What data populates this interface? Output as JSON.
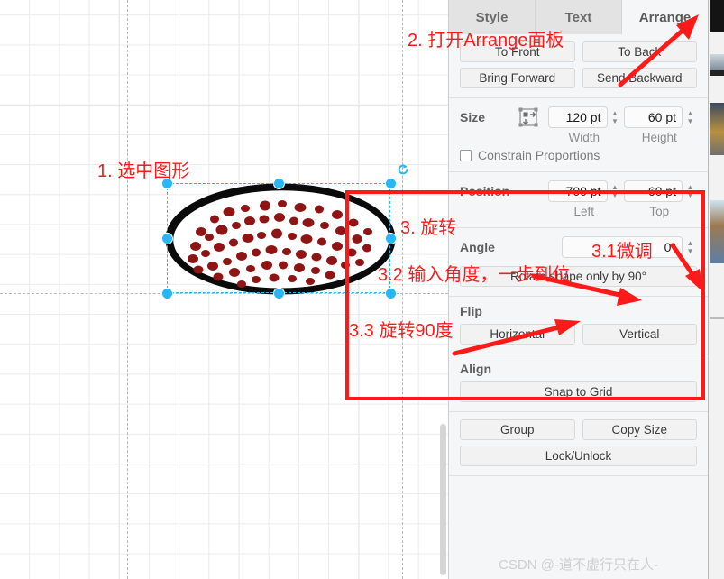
{
  "app": {
    "watermark": "CSDN @-道不虚行只在人-"
  },
  "panel": {
    "tabs": [
      {
        "label": "Style",
        "active": false
      },
      {
        "label": "Text",
        "active": false
      },
      {
        "label": "Arrange",
        "active": true
      }
    ],
    "order": {
      "to_front": "To Front",
      "to_back": "To Back",
      "bring_forward": "Bring Forward",
      "send_backward": "Send Backward"
    },
    "size": {
      "label": "Size",
      "icon": "autosize-icon",
      "width_value": "120 pt",
      "height_value": "60 pt",
      "width_label": "Width",
      "height_label": "Height",
      "constrain_label": "Constrain Proportions",
      "constrain_checked": false
    },
    "position": {
      "label": "Position",
      "left_value": "700 pt",
      "top_value": "-60 pt",
      "left_label": "Left",
      "top_label": "Top"
    },
    "angle": {
      "label": "Angle",
      "value": "0°",
      "rotate_button": "Rotate shape only by 90°"
    },
    "flip": {
      "label": "Flip",
      "horizontal": "Horizontal",
      "vertical": "Vertical"
    },
    "align": {
      "label": "Align",
      "snap_to_grid": "Snap to Grid"
    },
    "actions": {
      "group": "Group",
      "copy_size": "Copy Size",
      "lock_unlock": "Lock/Unlock"
    }
  },
  "canvas": {
    "shape_name": "spotted-ellipse-shape",
    "shape_outline_color": "#000000",
    "shape_spot_color": "#8f1515",
    "selection_color": "#29b6f6"
  },
  "annotations": {
    "a1": "1. 选中图形",
    "a2": "2. 打开Arrange面板",
    "a3": "3. 旋转",
    "a31": "3.1微调",
    "a32": "3.2 输入角度，一步到位",
    "a33": "3.3 旋转90度",
    "color": "#ff1a1a"
  }
}
